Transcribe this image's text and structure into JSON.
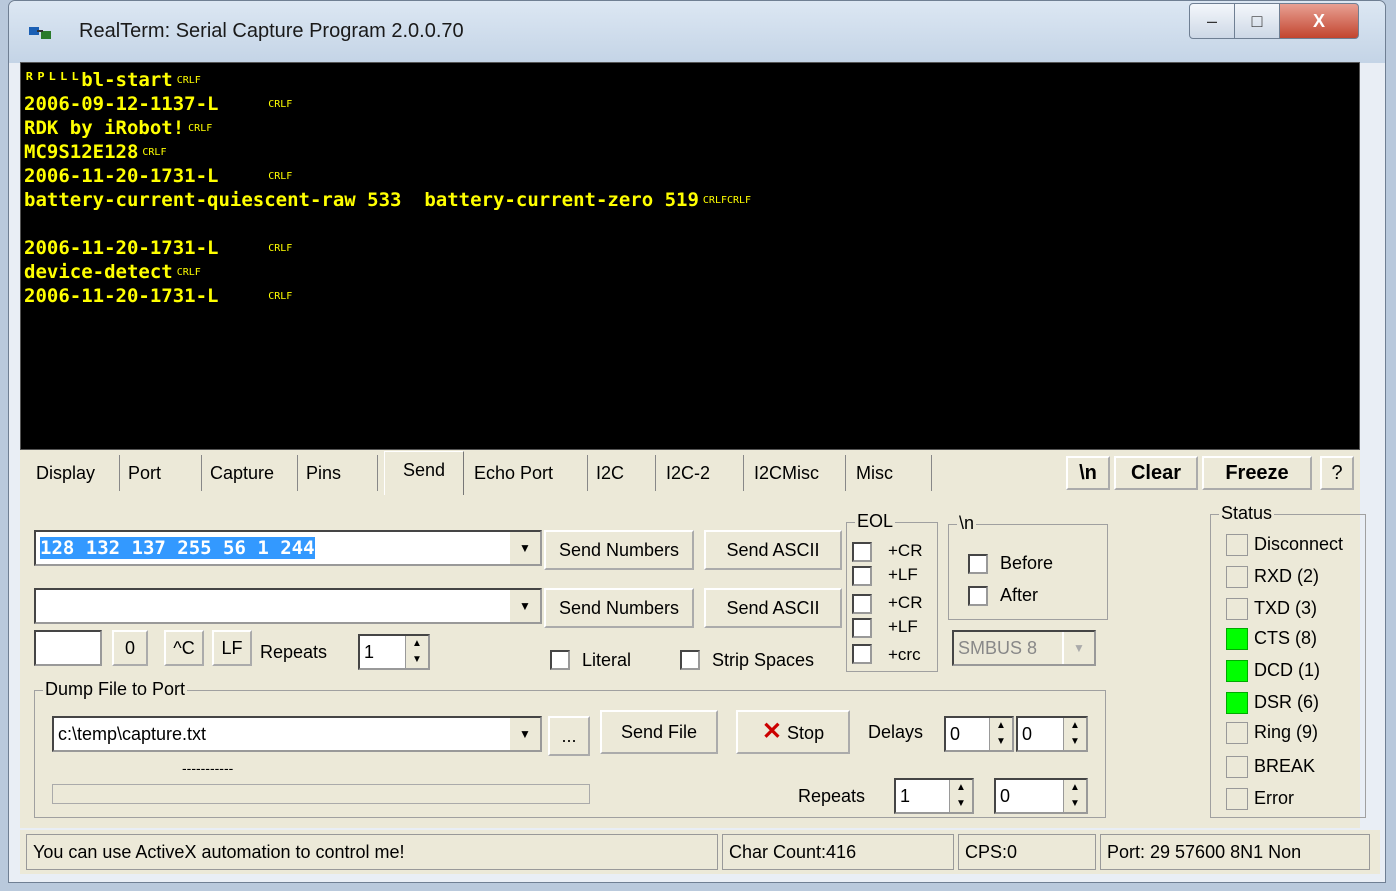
{
  "window": {
    "title": "RealTerm: Serial Capture Program 2.0.0.70",
    "minimize": "–",
    "maximize": "□",
    "close": "X"
  },
  "terminal": {
    "text_color": "#ffff00",
    "bg_color": "#000000",
    "lines": [
      {
        "text": "ᴿᴾᴸᴸᴸbl-start",
        "eol": "CRLF"
      },
      {
        "text": "2006-09-12-1137-L    ",
        "eol": "CRLF"
      },
      {
        "text": "RDK by iRobot!",
        "eol": "CRLF"
      },
      {
        "text": "MC9S12E128",
        "eol": "CRLF"
      },
      {
        "text": "2006-11-20-1731-L    ",
        "eol": "CRLF"
      },
      {
        "text": "battery-current-quiescent-raw 533  battery-current-zero 519",
        "eol": "CRLFCRLF"
      },
      {
        "text": "",
        "eol": ""
      },
      {
        "text": "2006-11-20-1731-L    ",
        "eol": "CRLF"
      },
      {
        "text": "device-detect",
        "eol": "CRLF"
      },
      {
        "text": "2006-11-20-1731-L    ",
        "eol": "CRLF"
      }
    ]
  },
  "tabs": [
    {
      "label": "Display"
    },
    {
      "label": "Port"
    },
    {
      "label": "Capture"
    },
    {
      "label": "Pins"
    },
    {
      "label": "Send",
      "active": true
    },
    {
      "label": "Echo Port"
    },
    {
      "label": "I2C"
    },
    {
      "label": "I2C-2"
    },
    {
      "label": "I2CMisc"
    },
    {
      "label": "Misc"
    }
  ],
  "toolbar": {
    "newline": "\\n",
    "clear": "Clear",
    "freeze": "Freeze",
    "help": "?"
  },
  "send": {
    "line1_value": "128 132 137 255 56 1 244",
    "line2_value": "",
    "send_numbers": "Send Numbers",
    "send_ascii": "Send ASCII",
    "small_edit": "",
    "zero_btn": "0",
    "ctrlc_btn": "^C",
    "lf_btn": "LF",
    "repeats_label": "Repeats",
    "repeats_value": "1",
    "literal": "Literal",
    "strip_spaces": "Strip Spaces",
    "eol_title": "EOL",
    "eol_items": [
      "+CR",
      "+LF",
      "+CR",
      "+LF",
      "+crc"
    ],
    "nl_title": "\\n",
    "before": "Before",
    "after": "After",
    "smbus": "SMBUS 8"
  },
  "dump": {
    "title": "Dump File to Port",
    "file": "c:\\temp\\capture.txt",
    "browse": "...",
    "send_file": "Send File",
    "stop": "Stop",
    "delays_label": "Delays",
    "delay1": "0",
    "delay2": "0",
    "dashes": "-----------",
    "repeats_label": "Repeats",
    "repeats1": "1",
    "repeats2": "0",
    "progress": 0
  },
  "status": {
    "title": "Status",
    "items": [
      {
        "label": "Disconnect",
        "on": false
      },
      {
        "label": "RXD (2)",
        "on": false
      },
      {
        "label": "TXD (3)",
        "on": false
      },
      {
        "label": "CTS (8)",
        "on": true
      },
      {
        "label": "DCD (1)",
        "on": true
      },
      {
        "label": "DSR (6)",
        "on": true
      },
      {
        "label": "Ring (9)",
        "on": false
      },
      {
        "label": "BREAK",
        "on": false
      },
      {
        "label": "Error",
        "on": false
      }
    ],
    "led_on_color": "#00ff00"
  },
  "statusbar": {
    "message": "You can use ActiveX automation to control me!",
    "char_count": "Char Count:416",
    "cps": "CPS:0",
    "port": "Port: 29 57600 8N1 Non"
  }
}
